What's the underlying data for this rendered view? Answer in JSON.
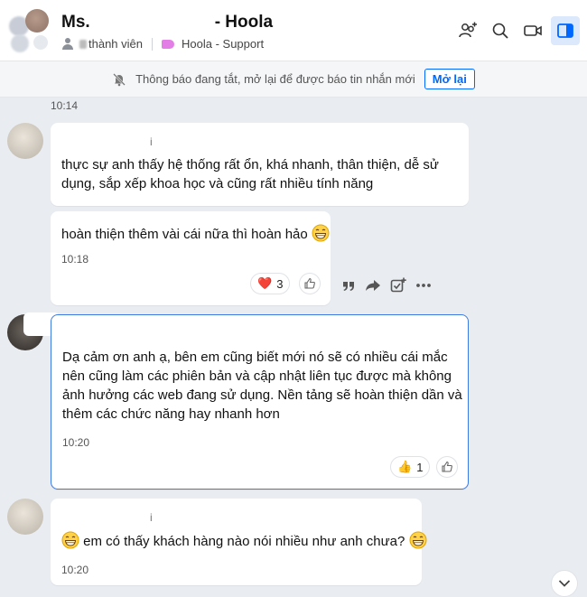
{
  "header": {
    "title_start": "Ms.",
    "title_end": "- Hoola",
    "members_label": "thành viên",
    "category_label": "Hoola - Support"
  },
  "notice": {
    "text": "Thông báo đang tắt, mở lại để được báo tin nhắn mới",
    "button_label": "Mở lại"
  },
  "top_time": "10:14",
  "messages": [
    {
      "sender": "i",
      "text": "thực sự anh thấy hệ thống rất ổn, khá nhanh, thân thiện, dễ sử dụng, sắp xếp khoa học và cũng rất nhiều tính năng"
    },
    {
      "text": "hoàn thiện thêm vài cái nữa thì hoàn hảo",
      "time": "10:18",
      "reaction": {
        "emoji": "❤️",
        "count": "3"
      }
    },
    {
      "text": "Dạ cảm ơn anh ạ, bên em cũng biết mới nó sẽ có nhiều cái mắc nên cũng làm các phiên bản và cập nhật liên tục được mà không ảnh hưởng các web đang sử dụng. Nền tảng sẽ hoàn thiện dần và thêm các chức năng hay nhanh hơn",
      "time": "10:20",
      "reaction": {
        "emoji": "👍",
        "count": "1"
      }
    },
    {
      "sender": "i",
      "text": "em có thấy khách hàng nào nói nhiều như anh chưa?",
      "time": "10:20"
    }
  ],
  "colors": {
    "accent": "#0068ff",
    "selected_border": "#3d7be0",
    "background": "#e9edf2"
  }
}
